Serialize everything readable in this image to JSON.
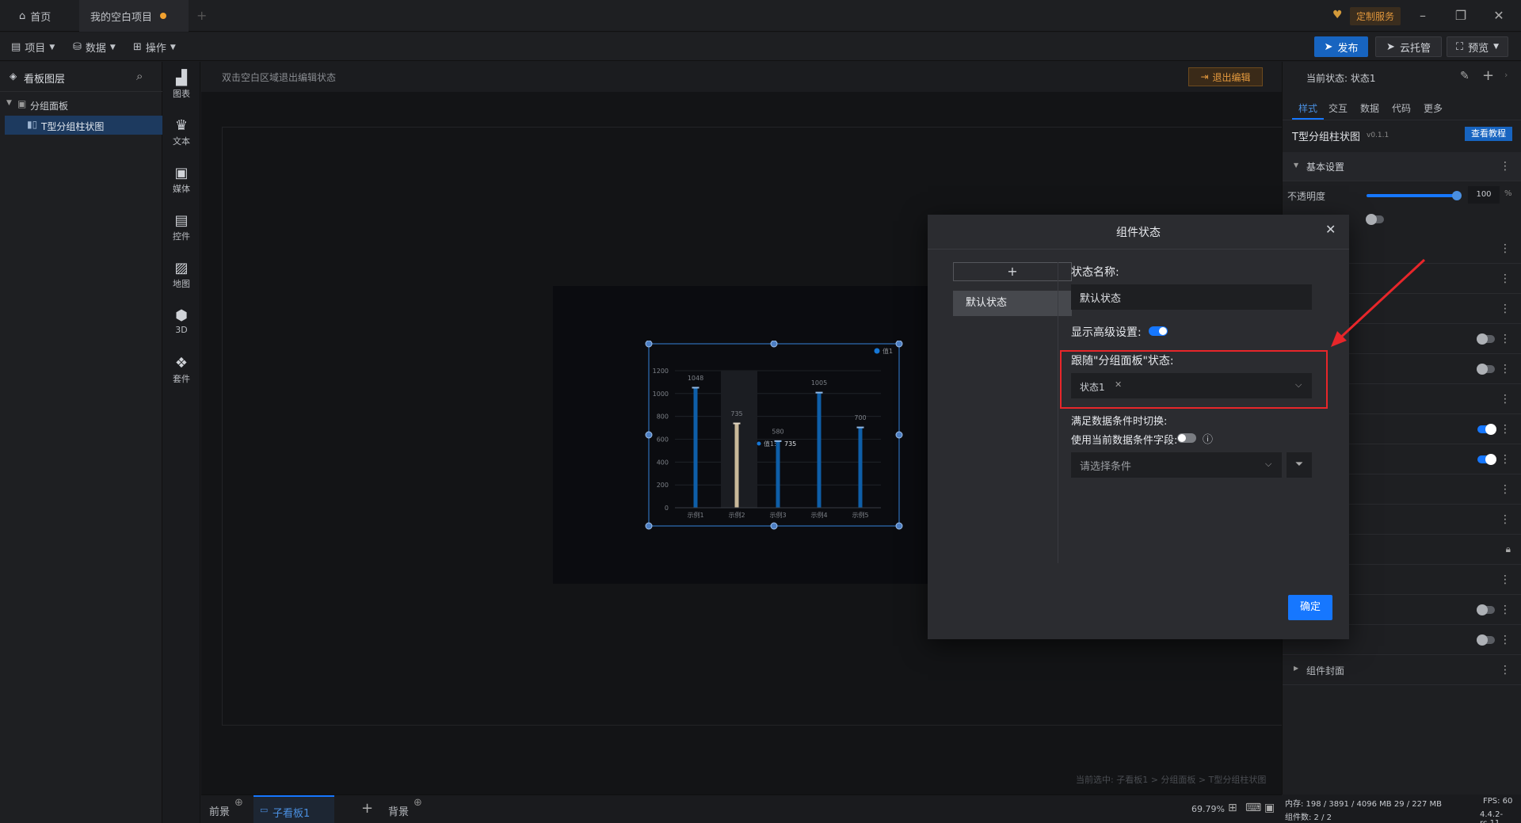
{
  "titlebar": {
    "home_tab": "首页",
    "project_tab": "我的空白项目",
    "custom_service": "定制服务"
  },
  "menubar": {
    "project": "项目",
    "data": "数据",
    "operation": "操作",
    "publish": "发布",
    "cloud_hosting": "云托管",
    "preview": "预览"
  },
  "layers": {
    "title": "看板图层",
    "group": "分组面板",
    "item": "T型分组柱状图"
  },
  "components": [
    "图表",
    "文本",
    "媒体",
    "控件",
    "地图",
    "3D",
    "套件"
  ],
  "canvas": {
    "hint": "双击空白区域退出编辑状态",
    "exit_edit": "退出编辑",
    "breadcrumb": "当前选中: 子看板1 > 分组面板 > T型分组柱状图"
  },
  "chart_data": {
    "type": "bar",
    "categories": [
      "示例1",
      "示例2",
      "示例3",
      "示例4",
      "示例5"
    ],
    "series": [
      {
        "name": "值1",
        "values": [
          1048,
          735,
          580,
          1005,
          700
        ]
      }
    ],
    "ylim": [
      0,
      1200
    ],
    "yticks": [
      "1200",
      "1000",
      "800",
      "600",
      "400",
      "200",
      "0"
    ],
    "tooltip": {
      "label": "值1:",
      "value": "735"
    },
    "legend_position": "top-right",
    "colors": {
      "bar": "#0e5ea8",
      "highlight": "#c9b99a"
    }
  },
  "bottombar": {
    "foreground": "前景",
    "sub_board": "子看板1",
    "background": "背景",
    "zoom": "69.79%"
  },
  "right": {
    "current_state": "当前状态: 状态1",
    "tabs": [
      "样式",
      "交互",
      "数据",
      "代码",
      "更多"
    ],
    "component_name": "T型分组柱状图",
    "version": "v0.1.1",
    "tutorial": "查看教程",
    "basic_settings": "基本设置",
    "opacity_label": "不透明度",
    "opacity_value": "100",
    "opacity_unit": "%",
    "cover": "组件封面",
    "memory": "内存: 198 / 3891 / 4096 MB  29 / 227 MB",
    "fps": "FPS: 60",
    "component_count": "组件数: 2 / 2",
    "build": "4.4.2-rc.11"
  },
  "modal": {
    "title": "组件状态",
    "add": "+",
    "default_state": "默认状态",
    "state_name_label": "状态名称:",
    "state_name_value": "默认状态",
    "show_advanced": "显示高级设置:",
    "follow_label": "跟随\"分组面板\"状态:",
    "follow_tag": "状态1",
    "switch_label": "满足数据条件时切换:",
    "use_field_label": "使用当前数据条件字段:",
    "condition_placeholder": "请选择条件",
    "confirm": "确定"
  }
}
